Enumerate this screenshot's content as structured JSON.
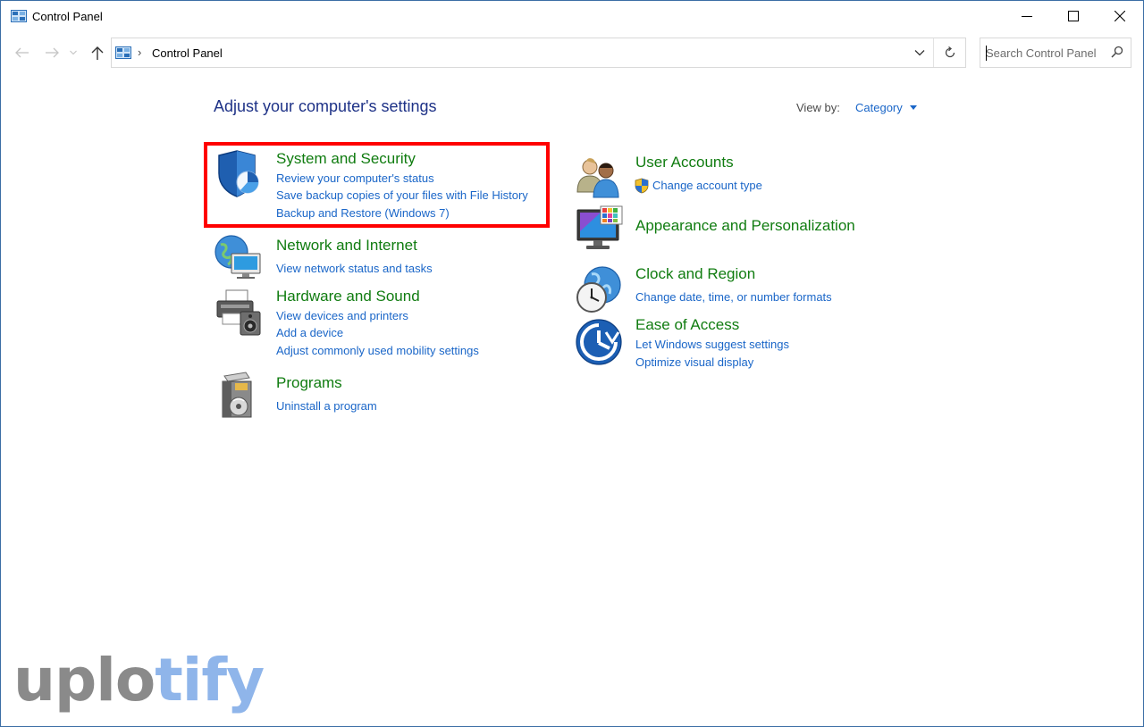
{
  "window": {
    "title": "Control Panel"
  },
  "address_bar": {
    "breadcrumb": "Control Panel",
    "search_placeholder": "Search Control Panel"
  },
  "main": {
    "heading": "Adjust your computer's settings",
    "view_by_label": "View by:",
    "view_by_value": "Category"
  },
  "categories": {
    "system_security": {
      "title": "System and Security",
      "links": [
        "Review your computer's status",
        "Save backup copies of your files with File History",
        "Backup and Restore (Windows 7)"
      ]
    },
    "network": {
      "title": "Network and Internet",
      "links": [
        "View network status and tasks"
      ]
    },
    "hardware": {
      "title": "Hardware and Sound",
      "links": [
        "View devices and printers",
        "Add a device",
        "Adjust commonly used mobility settings"
      ]
    },
    "programs": {
      "title": "Programs",
      "links": [
        "Uninstall a program"
      ]
    },
    "user_accounts": {
      "title": "User Accounts",
      "links": [
        "Change account type"
      ]
    },
    "appearance": {
      "title": "Appearance and Personalization",
      "links": []
    },
    "clock": {
      "title": "Clock and Region",
      "links": [
        "Change date, time, or number formats"
      ]
    },
    "ease": {
      "title": "Ease of Access",
      "links": [
        "Let Windows suggest settings",
        "Optimize visual display"
      ]
    }
  },
  "watermark": {
    "part1": "uplo",
    "part2": "tify"
  },
  "colors": {
    "category_title": "#107c10",
    "link": "#1a66c8",
    "heading": "#1e3287",
    "highlight": "#ff0000"
  }
}
